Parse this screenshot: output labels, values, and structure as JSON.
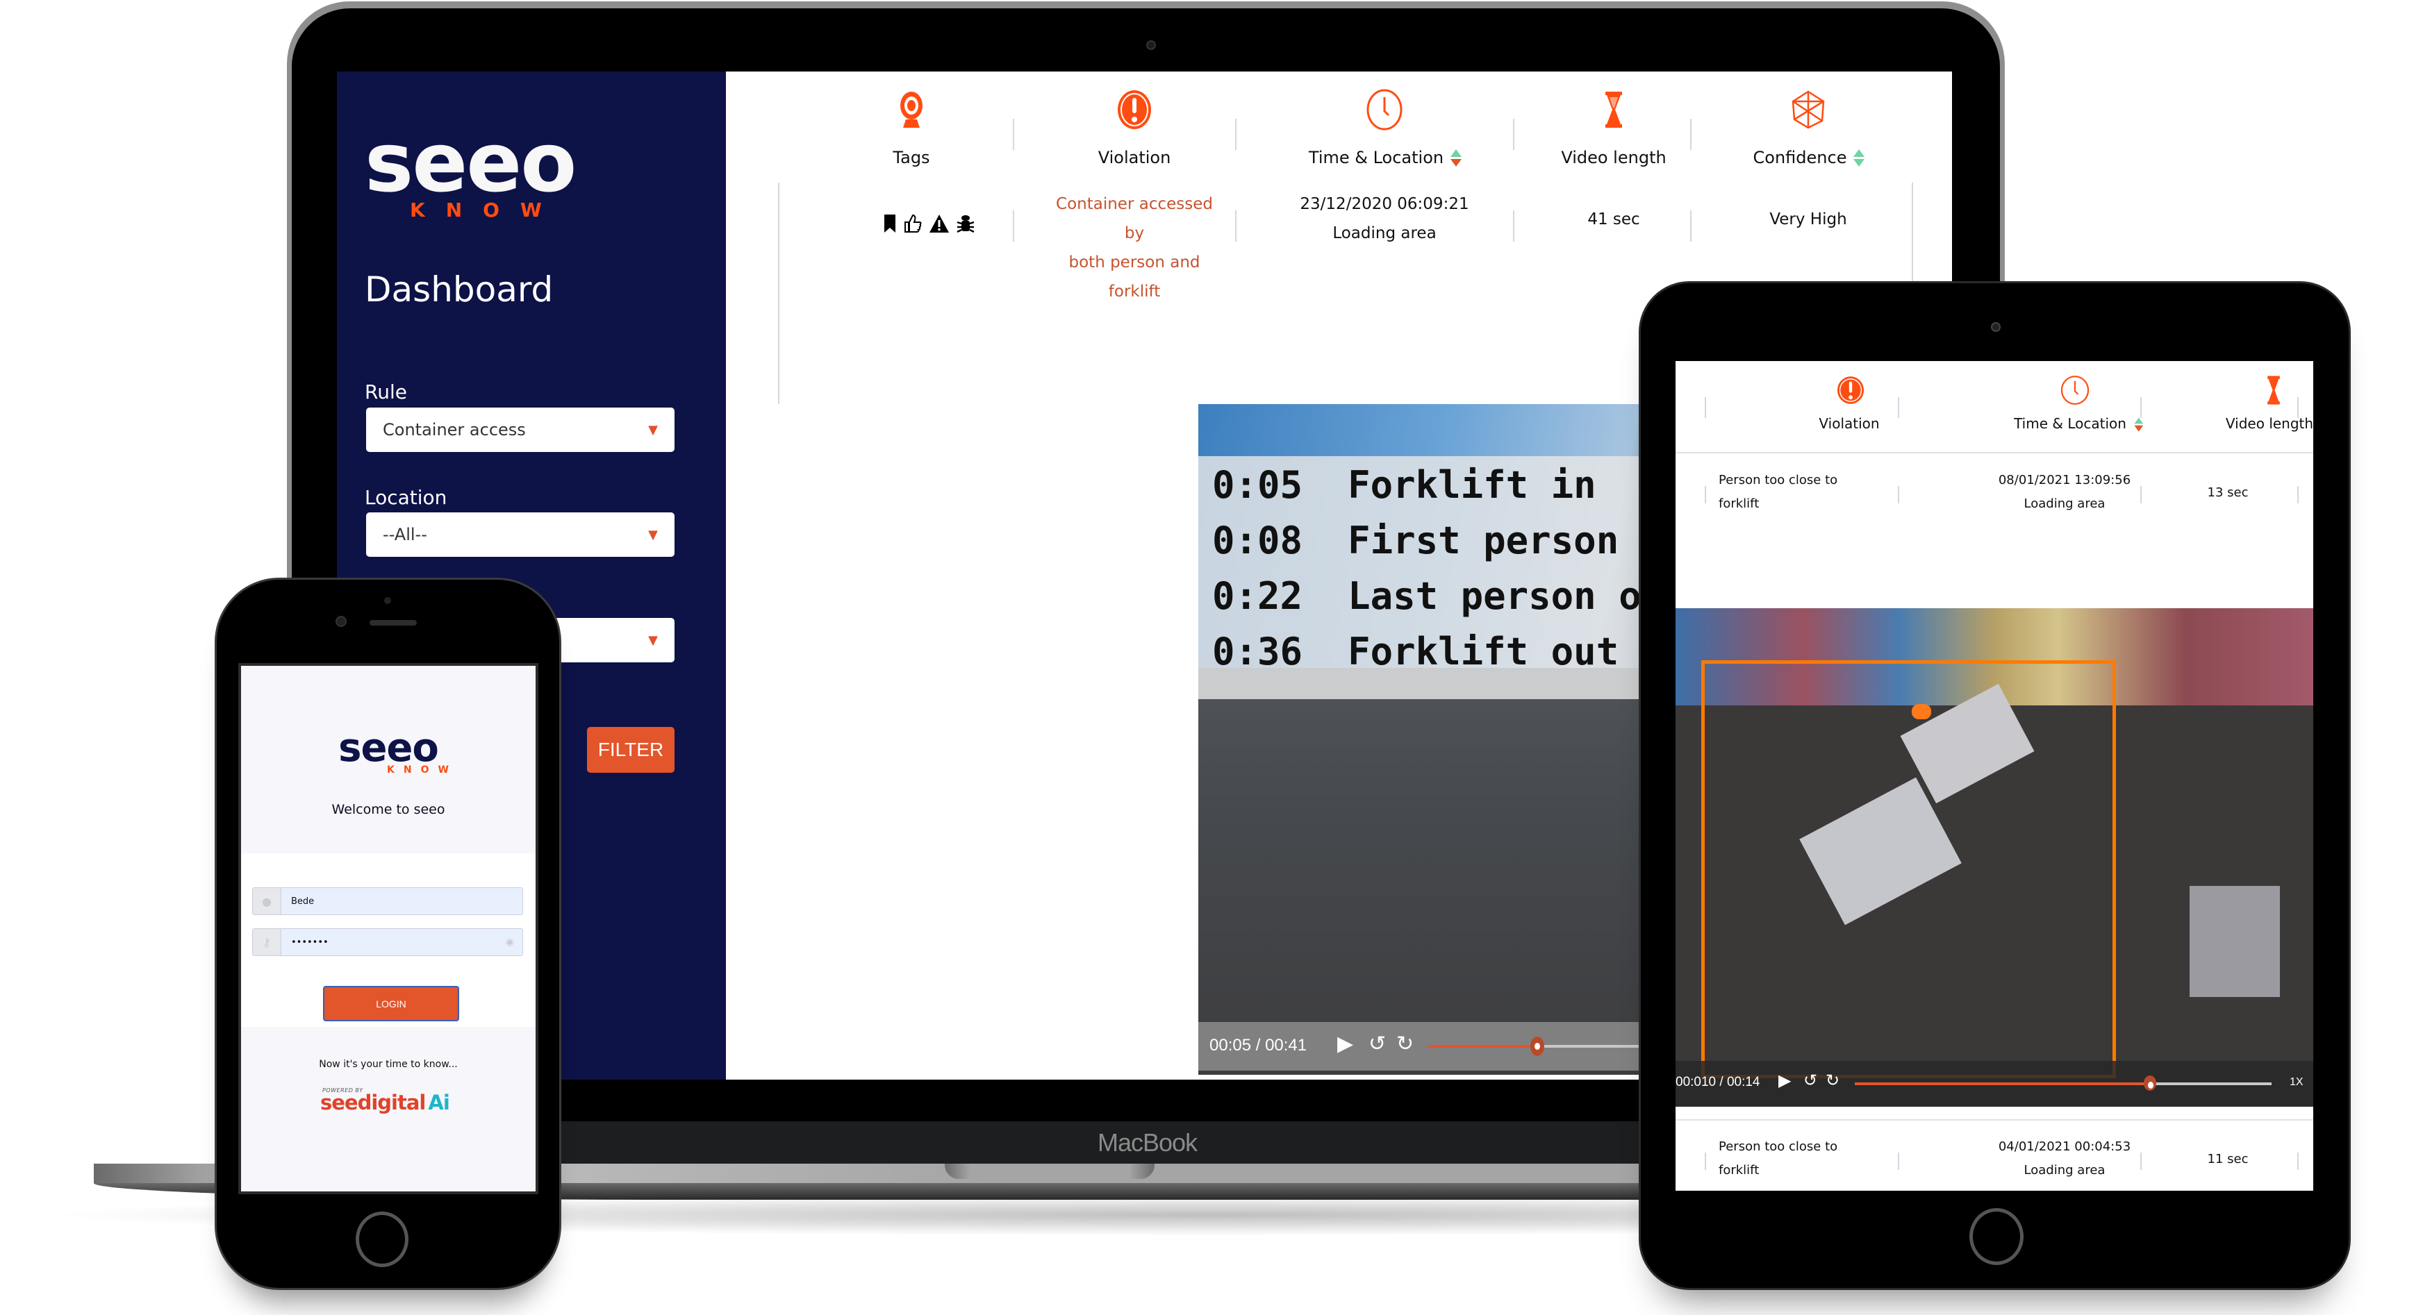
{
  "laptop": {
    "device_label": "MacBook",
    "sidebar": {
      "logo_main": "seeo",
      "logo_sub": "KNOW",
      "title": "Dashboard",
      "filters": [
        {
          "label": "Rule",
          "value": "Container access"
        },
        {
          "label": "Location",
          "value": "--All--"
        },
        {
          "label": "",
          "value": ""
        }
      ],
      "filter_button": "FILTER"
    },
    "table": {
      "columns": [
        {
          "label": "Tags",
          "icon": "webcam-icon",
          "sortable": false
        },
        {
          "label": "Violation",
          "icon": "alert-circle-icon",
          "sortable": false
        },
        {
          "label": "Time & Location",
          "icon": "clock-icon",
          "sortable": true
        },
        {
          "label": "Video length",
          "icon": "hourglass-icon",
          "sortable": false
        },
        {
          "label": "Confidence",
          "icon": "polyhedron-icon",
          "sortable": true
        }
      ],
      "rows": [
        {
          "tags": [
            "bookmark-icon",
            "thumbs-up-icon",
            "warning-icon",
            "bug-icon"
          ],
          "violation_line1": "Container accessed by",
          "violation_line2": "both person and forklift",
          "datetime": "23/12/2020 06:09:21",
          "location": "Loading area",
          "video_length": "41 sec",
          "confidence": "Very High"
        }
      ]
    },
    "video": {
      "overlay_lines": [
        {
          "time": "0:05",
          "event": "Forklift in"
        },
        {
          "time": "0:08",
          "event": "First person in"
        },
        {
          "time": "0:22",
          "event": "Last person out"
        },
        {
          "time": "0:36",
          "event": "Forklift out"
        }
      ],
      "time_display": "00:05 / 00:41",
      "progress_fraction": 0.12
    }
  },
  "phone": {
    "logo_main": "seeo",
    "logo_sub": "KNOW",
    "welcome": "Welcome to seeo",
    "username_value": "Bede",
    "password_value": "•••••••",
    "login_button": "LOGIN",
    "tagline": "Now it's your time to know...",
    "powered_by": "POWERED BY",
    "brand_name": "seedigital",
    "brand_suffix": "Ai"
  },
  "tablet": {
    "columns": [
      {
        "label": "Violation",
        "icon": "alert-circle-icon"
      },
      {
        "label": "Time & Location",
        "icon": "clock-icon",
        "sortable": true
      },
      {
        "label": "Video length",
        "icon": "hourglass-icon"
      }
    ],
    "rows": [
      {
        "violation_line1": "Person too close to",
        "violation_line2": "forklift",
        "datetime": "08/01/2021 13:09:56",
        "location": "Loading area",
        "video_length": "13 sec"
      },
      {
        "violation_line1": "Person too close to",
        "violation_line2": "forklift",
        "datetime": "04/01/2021 00:04:53",
        "location": "Loading area",
        "video_length": "11 sec"
      }
    ],
    "video": {
      "time_display": "00:010 / 00:14",
      "progress_fraction": 0.71,
      "speed": "1X"
    }
  },
  "colors": {
    "accent": "#e3552b",
    "brand_orange": "#ff4d12",
    "sidebar_bg": "#0d1247",
    "violation_text": "#c6532e",
    "sort_up": "#6fd3a3"
  }
}
